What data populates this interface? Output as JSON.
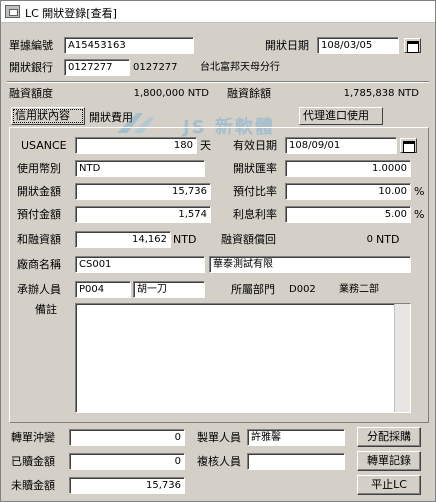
{
  "window": {
    "title": "LC 開狀登錄[查看]"
  },
  "header": {
    "app_no_label": "單據編號",
    "app_no": "A15453163",
    "open_date_label": "開狀日期",
    "open_date": "108/03/05",
    "bank_label": "開狀銀行",
    "bank_code": "0127277",
    "bank_code2": "0127277",
    "bank_name": "台北富邦天母分行"
  },
  "credit": {
    "limit_label": "融資額度",
    "limit_value": "1,800,000 NTD",
    "balance_label": "融資餘額",
    "balance_value": "1,785,838 NTD"
  },
  "tabs": {
    "content": "信用狀內容",
    "fees": "開狀費用",
    "import_agent": "代理進口使用"
  },
  "form": {
    "usance_label": "USANCE",
    "usance_value": "180",
    "usance_unit": "天",
    "valid_date_label": "有效日期",
    "valid_date": "108/09/01",
    "currency_label": "使用幣別",
    "currency_value": "NTD",
    "rate_label": "開狀匯率",
    "rate_value": "1.0000",
    "open_amount_label": "開狀金額",
    "open_amount": "15,736",
    "prepay_ratio_label": "預付比率",
    "prepay_ratio": "10.00",
    "prepay_amount_label": "預付金額",
    "prepay_amount": "1,574",
    "interest_label": "利息利率",
    "interest_value": "5.00",
    "percent": "%",
    "finance_label": "和融資額",
    "finance_amount": "14,162",
    "finance_currency": "NTD",
    "finance_return_label": "融資額償回",
    "finance_return": "0",
    "finance_return_currency": "NTD",
    "vendor_label": "廠商名稱",
    "vendor_code": "CS001",
    "vendor_name": "華泰測試有限",
    "handler_label": "承辦人員",
    "handler_code": "P004",
    "handler_name": "胡一刀",
    "dept_label": "所屬部門",
    "dept_code": "D002",
    "dept_name": "業務二部",
    "memo_label": "備註"
  },
  "footer": {
    "doc_pay_label": "轉單沖變",
    "doc_pay_value": "0",
    "creator_label": "製單人員",
    "creator_value": "許雅馨",
    "allocate_button": "分配採購",
    "redeemed_label": "已贖金額",
    "redeemed_value": "0",
    "reviewer_label": "複核人員",
    "reviewer_value": "",
    "history_button": "轉單記錄",
    "unredeemed_label": "未贖金額",
    "unredeemed_value": "15,736",
    "close_button": "平止LC"
  },
  "watermark": {
    "text": "JS 新軟體"
  }
}
